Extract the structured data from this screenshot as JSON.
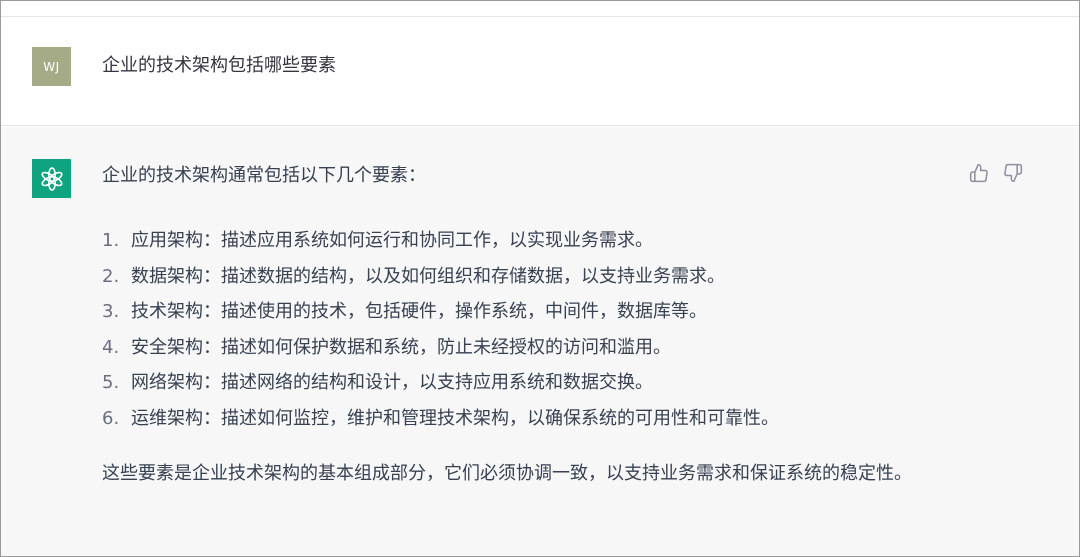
{
  "user": {
    "avatar_initials": "WJ",
    "message": "企业的技术架构包括哪些要素"
  },
  "assistant": {
    "intro": "企业的技术架构通常包括以下几个要素：",
    "points": [
      {
        "num": "1.",
        "text": "应用架构：描述应用系统如何运行和协同工作，以实现业务需求。"
      },
      {
        "num": "2.",
        "text": "数据架构：描述数据的结构，以及如何组织和存储数据，以支持业务需求。"
      },
      {
        "num": "3.",
        "text": "技术架构：描述使用的技术，包括硬件，操作系统，中间件，数据库等。"
      },
      {
        "num": "4.",
        "text": "安全架构：描述如何保护数据和系统，防止未经授权的访问和滥用。"
      },
      {
        "num": "5.",
        "text": "网络架构：描述网络的结构和设计，以支持应用系统和数据交换。"
      },
      {
        "num": "6.",
        "text": "运维架构：描述如何监控，维护和管理技术架构，以确保系统的可用性和可靠性。"
      }
    ],
    "outro": "这些要素是企业技术架构的基本组成部分，它们必须协调一致，以支持业务需求和保证系统的稳定性。"
  },
  "icons": {
    "assistant_avatar": "openai-logo-icon",
    "like": "thumbs-up-icon",
    "dislike": "thumbs-down-icon"
  },
  "colors": {
    "assistant_avatar_bg": "#10a37f",
    "user_avatar_bg": "#a5ab86",
    "assistant_row_bg": "#f7f7f8"
  }
}
